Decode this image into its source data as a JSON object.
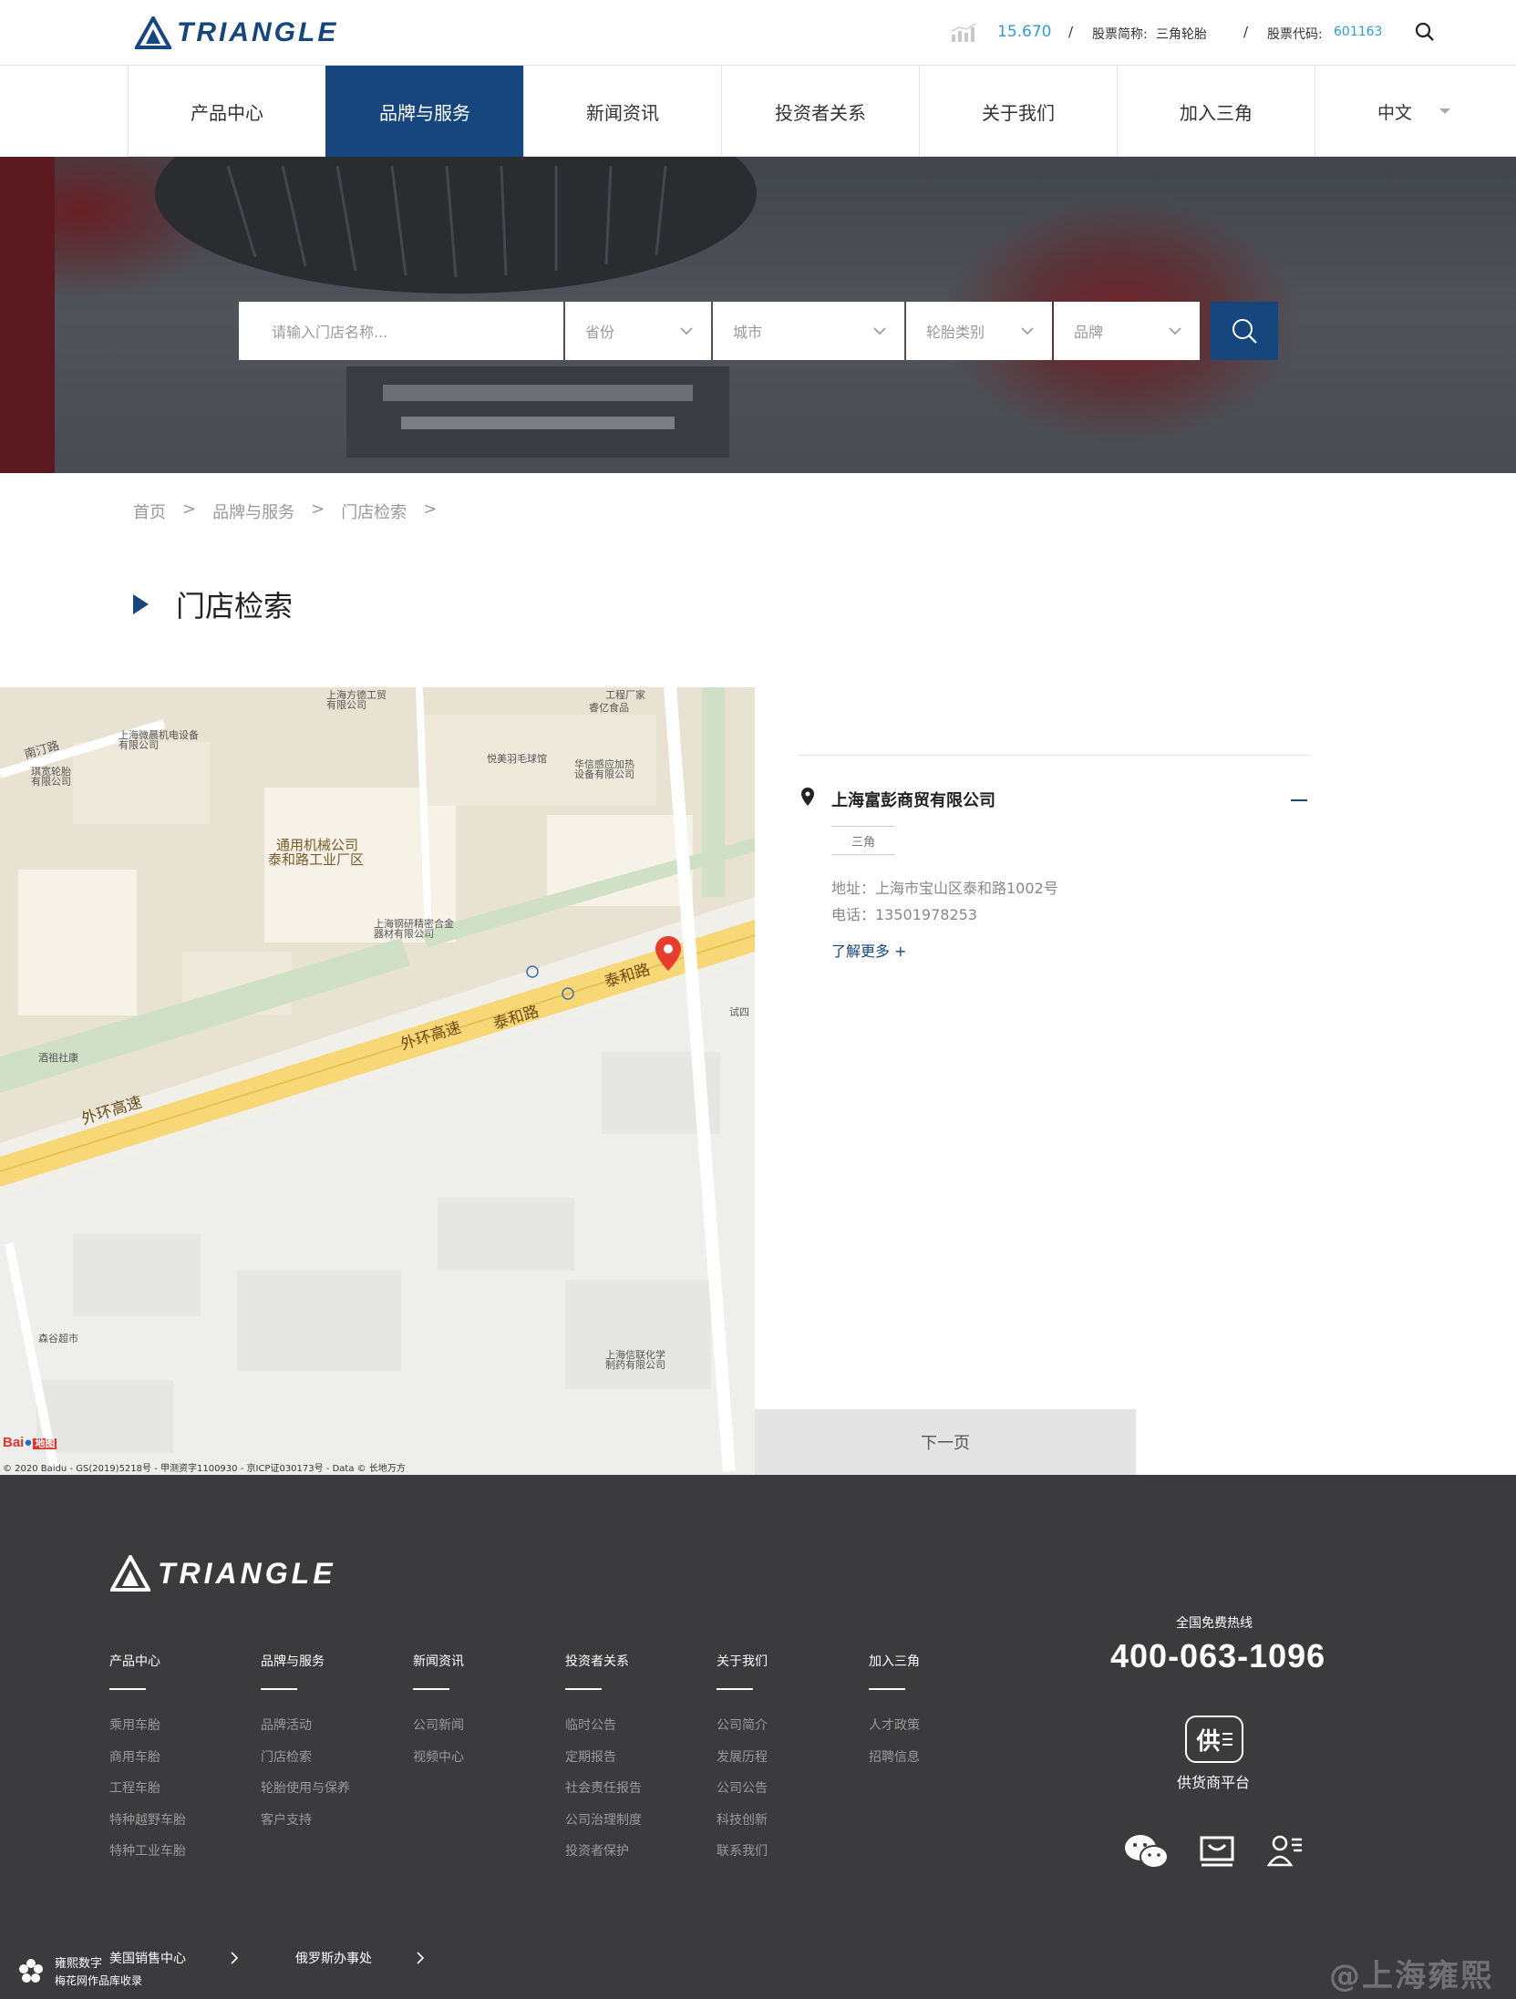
{
  "header": {
    "logo_text": "TRIANGLE",
    "stock_price": "15.670",
    "stock_name_label": "股票简称:",
    "stock_name": "三角轮胎",
    "stock_code_label": "股票代码:",
    "stock_code": "601163",
    "separator": "/"
  },
  "nav": {
    "items": [
      "产品中心",
      "品牌与服务",
      "新闻资讯",
      "投资者关系",
      "关于我们",
      "加入三角"
    ],
    "language": "中文"
  },
  "search": {
    "placeholder": "请输入门店名称...",
    "province": "省份",
    "city": "城市",
    "tire_type": "轮胎类别",
    "brand": "品牌"
  },
  "breadcrumb": [
    "首页",
    "品牌与服务",
    "门店检索"
  ],
  "breadcrumb_sep": ">",
  "page_title": "门店检索",
  "map": {
    "labels": {
      "nanting_rd": "南汀路",
      "shanghai_fangde_1": "上海方德工贸",
      "shanghai_fangde_2": "有限公司",
      "gongtai": "工程厂家",
      "ruiyi": "睿亿食品",
      "weizhan_1": "上海微晨机电设备",
      "weizhan_2": "有限公司",
      "qunxian_1": "琪宽轮胎",
      "qunxian_2": "有限公司",
      "yuemei": "悦美羽毛球馆",
      "huaxin_1": "华信感应加热",
      "huaxin_2": "设备有限公司",
      "tongyong_1": "通用机械公司",
      "tongyong_2": "泰和路工业厂区",
      "gangyan_1": "上海钢研精密合金",
      "gangyan_2": "器材有限公司",
      "taihe_rd_1": "泰和路",
      "taihe_rd_2": "泰和路",
      "waihuan_1": "外环高速",
      "waihuan_2": "外环高速",
      "jiuzu": "酒祖社康",
      "shisi": "试四",
      "senlin": "森谷超市",
      "xinlian_1": "上海信联化学",
      "xinlian_2": "制药有限公司",
      "baidu_brand": "Bai",
      "baidu_map": "地图",
      "copyright": "© 2020 Baidu - GS(2019)5218号 - 甲测资字1100930 - 京ICP证030173号 - Data © 长地万方"
    }
  },
  "store": {
    "name": "上海富彭商贸有限公司",
    "tag": "三角",
    "address": "地址：上海市宝山区泰和路1002号",
    "phone": "电话：13501978253",
    "more": "了解更多 +"
  },
  "pagination": {
    "next": "下一页"
  },
  "footer": {
    "logo_text": "TRIANGLE",
    "columns": [
      {
        "title": "产品中心",
        "items": [
          "乘用车胎",
          "商用车胎",
          "工程车胎",
          "特种越野车胎",
          "特种工业车胎"
        ]
      },
      {
        "title": "品牌与服务",
        "items": [
          "品牌活动",
          "门店检索",
          "轮胎使用与保养",
          "客户支持"
        ]
      },
      {
        "title": "新闻资讯",
        "items": [
          "公司新闻",
          "视频中心"
        ]
      },
      {
        "title": "投资者关系",
        "items": [
          "临时公告",
          "定期报告",
          "社会责任报告",
          "公司治理制度",
          "投资者保护"
        ]
      },
      {
        "title": "关于我们",
        "items": [
          "公司简介",
          "发展历程",
          "公司公告",
          "科技创新",
          "联系我们"
        ]
      },
      {
        "title": "加入三角",
        "items": [
          "人才政策",
          "招聘信息"
        ]
      }
    ],
    "hotline_label": "全国免费热线",
    "hotline": "400-063-1096",
    "supplier_icon": "供",
    "supplier_label": "供货商平台",
    "bottom_links": [
      "美国销售中心",
      "俄罗斯办事处"
    ],
    "credit_1": "雍熙数字",
    "credit_2": "梅花网作品库收录",
    "watermark": "@上海雍熙"
  },
  "colors": {
    "brand": "#17457e",
    "stock_blue": "#2f9cd8",
    "footer_bg": "#3b3b3d"
  }
}
